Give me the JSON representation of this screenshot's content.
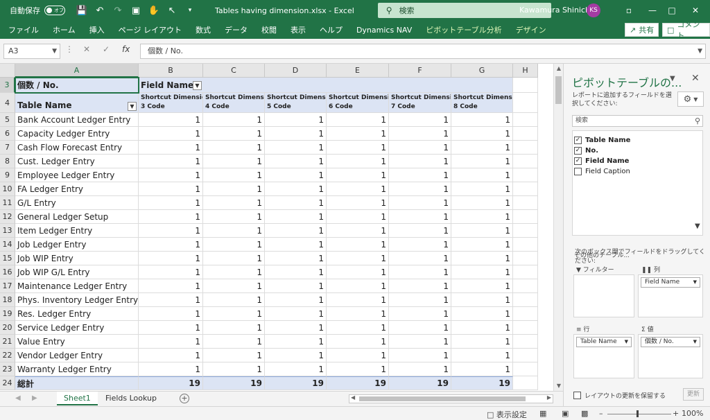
{
  "titlebar": {
    "autosave_label": "自動保存",
    "autosave_state": "オフ",
    "document_title": "Tables having dimension.xlsx  -  Excel",
    "search_label": "検索",
    "user_name": "Kawamura Shinichi",
    "user_initials": "KS",
    "avatar_color": "#a43ba3",
    "accent_color": "#217346"
  },
  "ribbon": {
    "tabs": [
      "ファイル",
      "ホーム",
      "挿入",
      "ページ レイアウト",
      "数式",
      "データ",
      "校閲",
      "表示",
      "ヘルプ",
      "Dynamics NAV",
      "ピボットテーブル分析",
      "デザイン"
    ],
    "share_label": "共有",
    "comment_label": "コメント"
  },
  "formulabar": {
    "name_box": "A3",
    "formula": "個数 / No."
  },
  "grid": {
    "columns": [
      "A",
      "B",
      "C",
      "D",
      "E",
      "F",
      "G",
      "H"
    ],
    "rows": [
      "3",
      "4",
      "5",
      "6",
      "7",
      "8",
      "9",
      "10",
      "11",
      "12",
      "13",
      "14",
      "15",
      "16",
      "17",
      "18",
      "19",
      "20",
      "21",
      "22",
      "23",
      "24"
    ],
    "value_label": "個数 / No.",
    "column_field_label": "Field Name",
    "row_field_label": "Table Name",
    "field_headers": [
      [
        "Shortcut Dimension",
        "3 Code"
      ],
      [
        "Shortcut Dimension",
        "4 Code"
      ],
      [
        "Shortcut Dimension",
        "5 Code"
      ],
      [
        "Shortcut Dimension",
        "6 Code"
      ],
      [
        "Shortcut Dimension",
        "7 Code"
      ],
      [
        "Shortcut Dimension",
        "8 Code"
      ]
    ],
    "data_rows": [
      {
        "name": "Bank Account Ledger Entry",
        "values": [
          1,
          1,
          1,
          1,
          1,
          1
        ]
      },
      {
        "name": "Capacity Ledger Entry",
        "values": [
          1,
          1,
          1,
          1,
          1,
          1
        ]
      },
      {
        "name": "Cash Flow Forecast Entry",
        "values": [
          1,
          1,
          1,
          1,
          1,
          1
        ]
      },
      {
        "name": "Cust. Ledger Entry",
        "values": [
          1,
          1,
          1,
          1,
          1,
          1
        ]
      },
      {
        "name": "Employee Ledger Entry",
        "values": [
          1,
          1,
          1,
          1,
          1,
          1
        ]
      },
      {
        "name": "FA Ledger Entry",
        "values": [
          1,
          1,
          1,
          1,
          1,
          1
        ]
      },
      {
        "name": "G/L Entry",
        "values": [
          1,
          1,
          1,
          1,
          1,
          1
        ]
      },
      {
        "name": "General Ledger Setup",
        "values": [
          1,
          1,
          1,
          1,
          1,
          1
        ]
      },
      {
        "name": "Item Ledger Entry",
        "values": [
          1,
          1,
          1,
          1,
          1,
          1
        ]
      },
      {
        "name": "Job Ledger Entry",
        "values": [
          1,
          1,
          1,
          1,
          1,
          1
        ]
      },
      {
        "name": "Job WIP Entry",
        "values": [
          1,
          1,
          1,
          1,
          1,
          1
        ]
      },
      {
        "name": "Job WIP G/L Entry",
        "values": [
          1,
          1,
          1,
          1,
          1,
          1
        ]
      },
      {
        "name": "Maintenance Ledger Entry",
        "values": [
          1,
          1,
          1,
          1,
          1,
          1
        ]
      },
      {
        "name": "Phys. Inventory Ledger Entry",
        "values": [
          1,
          1,
          1,
          1,
          1,
          1
        ]
      },
      {
        "name": "Res. Ledger Entry",
        "values": [
          1,
          1,
          1,
          1,
          1,
          1
        ]
      },
      {
        "name": "Service Ledger Entry",
        "values": [
          1,
          1,
          1,
          1,
          1,
          1
        ]
      },
      {
        "name": "Value Entry",
        "values": [
          1,
          1,
          1,
          1,
          1,
          1
        ]
      },
      {
        "name": "Vendor Ledger Entry",
        "values": [
          1,
          1,
          1,
          1,
          1,
          1
        ]
      },
      {
        "name": "Warranty Ledger Entry",
        "values": [
          1,
          1,
          1,
          1,
          1,
          1
        ]
      }
    ],
    "total_row": {
      "name": "総計",
      "values": [
        19,
        19,
        19,
        19,
        19,
        19
      ]
    },
    "header_band_color": "#dce4f4"
  },
  "sheets": {
    "tabs": [
      {
        "label": "Sheet1",
        "active": true
      },
      {
        "label": "Fields Lookup",
        "active": false
      }
    ]
  },
  "statusbar": {
    "display_settings": "表示設定",
    "zoom": "100%"
  },
  "pivot_pane": {
    "title": "ピボットテーブルの...",
    "hint": "レポートに追加するフィールドを選択してください:",
    "search_placeholder": "検索",
    "fields": [
      {
        "label": "Table Name",
        "checked": true
      },
      {
        "label": "No.",
        "checked": true
      },
      {
        "label": "Field Name",
        "checked": true
      },
      {
        "label": "Field Caption",
        "checked": false
      }
    ],
    "more_tables": "その他のテーブル...",
    "drag_hint": "次のボックス間でフィールドをドラッグしてください:",
    "areas": {
      "filters_label": "フィルター",
      "columns_label": "列",
      "rows_label": "行",
      "values_label": "値",
      "columns_item": "Field Name",
      "rows_item": "Table Name",
      "values_item": "個数 / No."
    },
    "defer_label": "レイアウトの更新を保留する",
    "update_label": "更新"
  }
}
